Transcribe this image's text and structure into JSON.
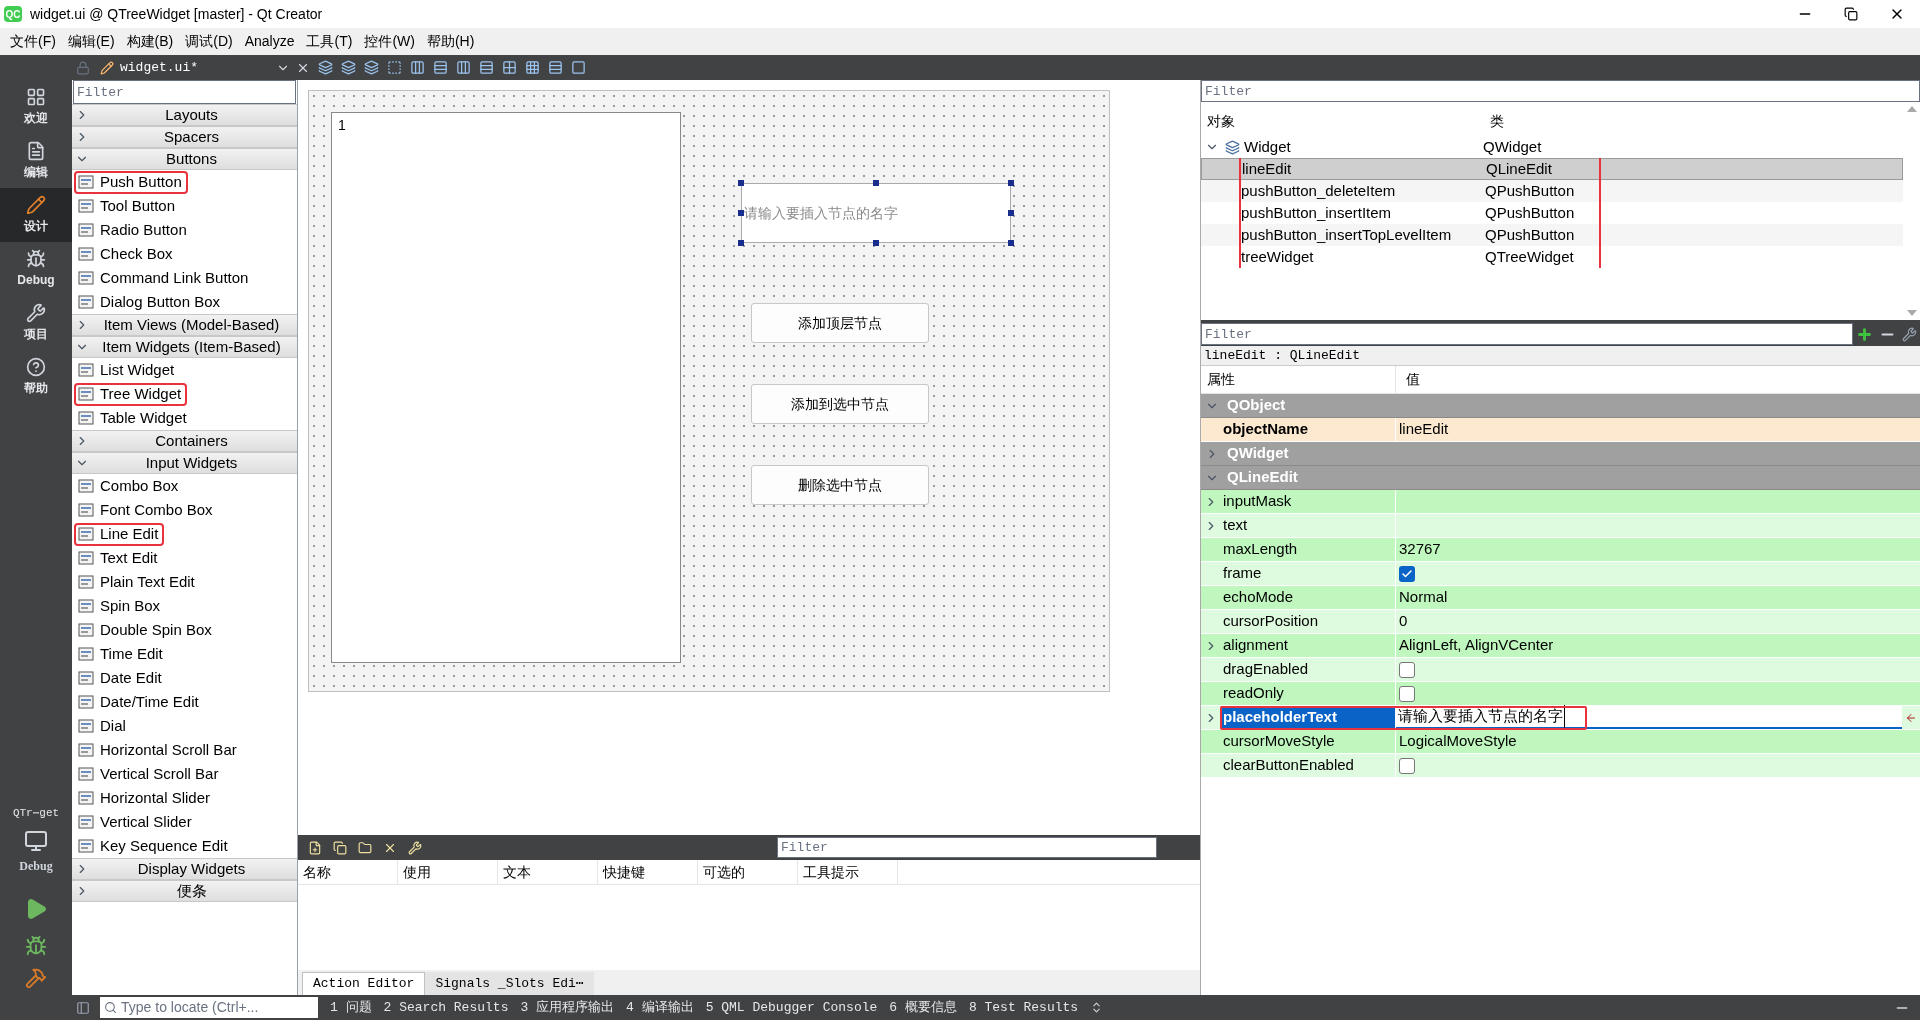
{
  "window": {
    "app_icon": "QC",
    "title": "widget.ui @ QTreeWidget [master] - Qt Creator"
  },
  "menu": [
    "文件(F)",
    "编辑(E)",
    "构建(B)",
    "调试(D)",
    "Analyze",
    "工具(T)",
    "控件(W)",
    "帮助(H)"
  ],
  "modes": [
    {
      "label": "欢迎",
      "selected": false
    },
    {
      "label": "编辑",
      "selected": false
    },
    {
      "label": "设计",
      "selected": true
    },
    {
      "label": "Debug",
      "selected": false
    },
    {
      "label": "项目",
      "selected": false
    },
    {
      "label": "帮助",
      "selected": false
    }
  ],
  "kit": {
    "project": "QTr⋯get",
    "build": "Debug"
  },
  "editor_toolbar": {
    "file": "widget.ui*"
  },
  "widget_box": {
    "filter_placeholder": "Filter",
    "sections": [
      {
        "title": "Layouts",
        "expanded": false
      },
      {
        "title": "Spacers",
        "expanded": false
      },
      {
        "title": "Buttons",
        "expanded": true,
        "items": [
          {
            "label": "Push Button",
            "highlighted": true
          },
          {
            "label": "Tool Button",
            "highlighted": false
          },
          {
            "label": "Radio Button",
            "highlighted": false
          },
          {
            "label": "Check Box",
            "highlighted": false
          },
          {
            "label": "Command Link Button",
            "highlighted": false
          },
          {
            "label": "Dialog Button Box",
            "highlighted": false
          }
        ]
      },
      {
        "title": "Item Views (Model-Based)",
        "expanded": false
      },
      {
        "title": "Item Widgets (Item-Based)",
        "expanded": true,
        "items": [
          {
            "label": "List Widget",
            "highlighted": false
          },
          {
            "label": "Tree Widget",
            "highlighted": true
          },
          {
            "label": "Table Widget",
            "highlighted": false
          }
        ]
      },
      {
        "title": "Containers",
        "expanded": false
      },
      {
        "title": "Input Widgets",
        "expanded": true,
        "items": [
          {
            "label": "Combo Box",
            "highlighted": false
          },
          {
            "label": "Font Combo Box",
            "highlighted": false
          },
          {
            "label": "Line Edit",
            "highlighted": true
          },
          {
            "label": "Text Edit",
            "highlighted": false
          },
          {
            "label": "Plain Text Edit",
            "highlighted": false
          },
          {
            "label": "Spin Box",
            "highlighted": false
          },
          {
            "label": "Double Spin Box",
            "highlighted": false
          },
          {
            "label": "Time Edit",
            "highlighted": false
          },
          {
            "label": "Date Edit",
            "highlighted": false
          },
          {
            "label": "Date/Time Edit",
            "highlighted": false
          },
          {
            "label": "Dial",
            "highlighted": false
          },
          {
            "label": "Horizontal Scroll Bar",
            "highlighted": false
          },
          {
            "label": "Vertical Scroll Bar",
            "highlighted": false
          },
          {
            "label": "Horizontal Slider",
            "highlighted": false
          },
          {
            "label": "Vertical Slider",
            "highlighted": false
          },
          {
            "label": "Key Sequence Edit",
            "highlighted": false
          }
        ]
      },
      {
        "title": "Display Widgets",
        "expanded": false
      },
      {
        "title": "便条",
        "expanded": false
      }
    ]
  },
  "form": {
    "tree_header": "1",
    "line_edit_placeholder": "请输入要插入节点的名字",
    "buttons": [
      "添加顶层节点",
      "添加到选中节点",
      "删除选中节点"
    ]
  },
  "action_editor": {
    "filter_placeholder": "Filter",
    "columns": [
      "名称",
      "使用",
      "文本",
      "快捷键",
      "可选的",
      "工具提示"
    ],
    "tabs": [
      {
        "label": "Action Editor",
        "selected": true
      },
      {
        "label": "Signals _Slots Edi⋯",
        "selected": false
      }
    ]
  },
  "object_inspector": {
    "filter_placeholder": "Filter",
    "columns": [
      "对象",
      "类"
    ],
    "root": {
      "name": "Widget",
      "class": "QWidget",
      "expanded": true,
      "children": [
        {
          "name": "lineEdit",
          "class": "QLineEdit",
          "selected": true,
          "highlighted": true
        },
        {
          "name": "pushButton_deleteItem",
          "class": "QPushButton",
          "selected": false,
          "highlighted": true
        },
        {
          "name": "pushButton_insertItem",
          "class": "QPushButton",
          "selected": false,
          "highlighted": true
        },
        {
          "name": "pushButton_insertTopLevelItem",
          "class": "QPushButton",
          "selected": false,
          "highlighted": true
        },
        {
          "name": "treeWidget",
          "class": "QTreeWidget",
          "selected": false,
          "highlighted": true
        }
      ]
    }
  },
  "property_editor": {
    "filter_placeholder": "Filter",
    "object_label": "lineEdit : QLineEdit",
    "columns": [
      "属性",
      "值"
    ],
    "groups": [
      {
        "name": "QObject",
        "expanded": true,
        "color": "#fde9d0",
        "properties": [
          {
            "name": "objectName",
            "kind": "text",
            "value": "lineEdit",
            "bold": true,
            "expandable": false,
            "selected": false
          }
        ]
      },
      {
        "name": "QWidget",
        "expanded": false
      },
      {
        "name": "QLineEdit",
        "expanded": true,
        "color": "#bff7bf",
        "properties": [
          {
            "name": "inputMask",
            "kind": "text",
            "bold": false,
            "expandable": true,
            "selected": false
          },
          {
            "name": "text",
            "kind": "text",
            "bold": false,
            "expandable": true,
            "selected": false
          },
          {
            "name": "maxLength",
            "kind": "text",
            "value": "32767",
            "bold": false,
            "expandable": false,
            "selected": false
          },
          {
            "name": "frame",
            "kind": "checkbox",
            "checked": true,
            "bold": false,
            "expandable": false,
            "selected": false
          },
          {
            "name": "echoMode",
            "kind": "text",
            "value": "Normal",
            "bold": false,
            "expandable": false,
            "selected": false
          },
          {
            "name": "cursorPosition",
            "kind": "text",
            "value": "0",
            "bold": false,
            "expandable": false,
            "selected": false
          },
          {
            "name": "alignment",
            "kind": "text",
            "value": "AlignLeft, AlignVCenter",
            "bold": false,
            "expandable": true,
            "selected": false
          },
          {
            "name": "dragEnabled",
            "kind": "checkbox",
            "checked": false,
            "bold": false,
            "expandable": false,
            "selected": false
          },
          {
            "name": "readOnly",
            "kind": "checkbox",
            "checked": false,
            "bold": false,
            "expandable": false,
            "selected": false
          },
          {
            "name": "placeholderText",
            "kind": "text",
            "value": "请输入要插入节点的名字",
            "bold": true,
            "expandable": true,
            "selected": true,
            "highlighted": true
          },
          {
            "name": "cursorMoveStyle",
            "kind": "text",
            "value": "LogicalMoveStyle",
            "bold": false,
            "expandable": false,
            "selected": false
          },
          {
            "name": "clearButtonEnabled",
            "kind": "checkbox",
            "checked": false,
            "bold": false,
            "expandable": false,
            "selected": false
          }
        ]
      }
    ]
  },
  "status_bar": {
    "locator_placeholder": "Type to locate (Ctrl+...",
    "panes": [
      "1 问题",
      "2 Search Results",
      "3 应用程序输出",
      "4 编译输出",
      "5 QML Debugger Console",
      "6 概要信息",
      "8 Test Results"
    ]
  }
}
